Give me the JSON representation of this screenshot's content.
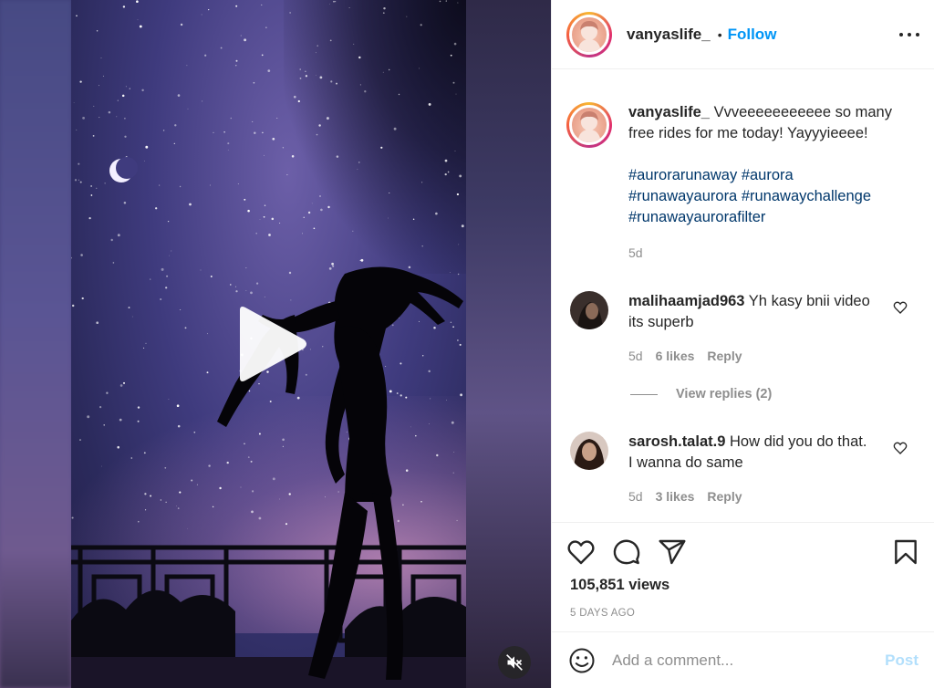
{
  "post": {
    "username": "vanyaslife_",
    "separator": "•",
    "follow_label": "Follow",
    "caption_text": "Vvveeeeeeeeeee so many free rides for me today! Yayyyieeee!",
    "hashtags": [
      "#aurorarunaway #aurora",
      "#runawayaurora #runawaychallenge",
      "#runawayaurorafilter"
    ],
    "caption_time": "5d",
    "views": "105,851 views",
    "posted_ago": "5 DAYS AGO"
  },
  "comments": [
    {
      "username": "malihaamjad963",
      "text": "Yh kasy bnii video its superb",
      "time": "5d",
      "likes": "6 likes",
      "reply_label": "Reply"
    },
    {
      "username": "sarosh.talat.9",
      "text": "How did you do that. I wanna do same",
      "time": "5d",
      "likes": "3 likes",
      "reply_label": "Reply"
    }
  ],
  "view_replies": "View replies (2)",
  "add_comment": {
    "placeholder": "Add a comment...",
    "post_label": "Post"
  },
  "icons": {
    "more": "more-icon",
    "like": "heart-icon",
    "comment": "comment-icon",
    "share": "paper-plane-icon",
    "save": "bookmark-icon",
    "emoji": "emoji-icon",
    "play": "play-icon",
    "mute": "muted-speaker-icon"
  },
  "colors": {
    "accent": "#0095f6",
    "hashtag": "#00376b",
    "muted_text": "#8e8e8e",
    "post_disabled": "#b2dffc"
  }
}
